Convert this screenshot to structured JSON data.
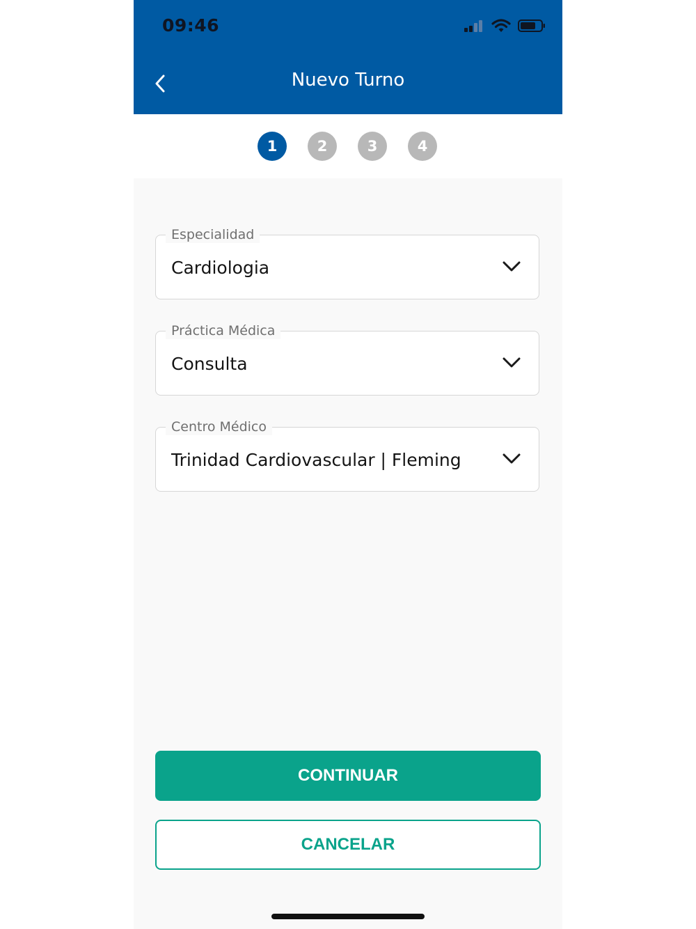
{
  "status_bar": {
    "time": "09:46",
    "icons": [
      "signal-icon",
      "wifi-icon",
      "battery-icon"
    ]
  },
  "header": {
    "title": "Nuevo Turno",
    "back_icon": "chevron-left-icon",
    "background": "#005aa3"
  },
  "stepper": {
    "steps": [
      "1",
      "2",
      "3",
      "4"
    ],
    "active_step": 1,
    "active_color": "#005aa3",
    "inactive_color": "#b8b8b8"
  },
  "form": {
    "especialidad": {
      "label": "Especialidad",
      "value": "Cardiologia"
    },
    "practica": {
      "label": "Práctica Médica",
      "value": "Consulta"
    },
    "centro": {
      "label": "Centro Médico",
      "value": "Trinidad Cardiovascular | Fleming"
    }
  },
  "actions": {
    "continue_label": "CONTINUAR",
    "cancel_label": "CANCELAR",
    "accent": "#0aa38b"
  }
}
